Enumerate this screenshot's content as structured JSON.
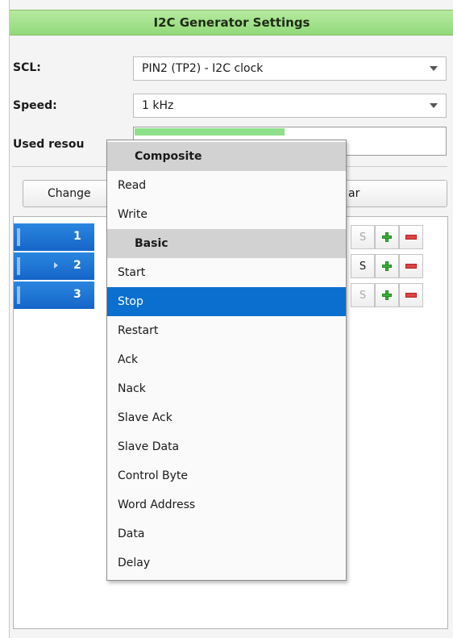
{
  "title": "I2C Generator Settings",
  "scl": {
    "label": "SCL:",
    "value": "PIN2 (TP2) - I2C clock"
  },
  "speed": {
    "label": "Speed:",
    "value": "1 kHz"
  },
  "resources": {
    "label": "Used resou",
    "usage_fraction": 0.48
  },
  "buttons": {
    "change": "Change",
    "clear": "ar"
  },
  "sequence": [
    {
      "number": "1",
      "s": "S"
    },
    {
      "number": "2",
      "s": "S"
    },
    {
      "number": "3",
      "s": "S"
    }
  ],
  "menu": {
    "header_composite": "Composite",
    "composite": [
      "Read",
      "Write"
    ],
    "header_basic": "Basic",
    "basic": [
      "Start",
      "Stop",
      "Restart",
      "Ack",
      "Nack",
      "Slave Ack",
      "Slave Data",
      "Control Byte",
      "Word Address",
      "Data",
      "Delay"
    ],
    "selected": "Stop"
  },
  "colors": {
    "title_green": "#a3e38c",
    "selection_blue": "#0b6fcf",
    "resource_bar": "#8fe08a"
  }
}
